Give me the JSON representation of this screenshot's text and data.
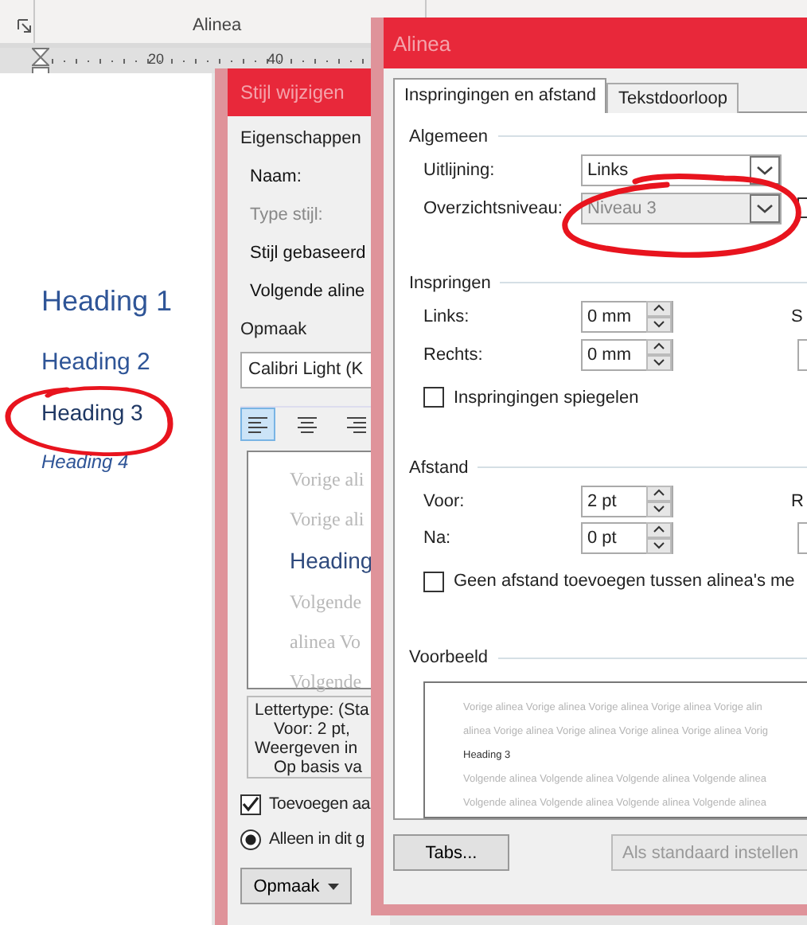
{
  "ribbon": {
    "group_label": "Alinea"
  },
  "ruler": {
    "marks": [
      "20",
      "40"
    ]
  },
  "document": {
    "headings": [
      {
        "kind": "h1",
        "text": "Heading 1"
      },
      {
        "kind": "h2",
        "text": "Heading 2"
      },
      {
        "kind": "h3",
        "text": "Heading 3"
      },
      {
        "kind": "h4",
        "text": "Heading 4"
      }
    ]
  },
  "style_dialog": {
    "title": "Stijl wijzigen",
    "properties_heading": "Eigenschappen",
    "fields": [
      {
        "label": "Naam:",
        "disabled": false
      },
      {
        "label": "Type stijl:",
        "disabled": true
      },
      {
        "label": "Stijl gebaseerd",
        "disabled": false
      },
      {
        "label": "Volgende aline",
        "disabled": false
      }
    ],
    "format_heading": "Opmaak",
    "font": "Calibri Light (K",
    "alignment_buttons": [
      {
        "selected": true
      },
      {
        "selected": false
      },
      {
        "selected": false
      }
    ],
    "preview_lines": [
      {
        "kind": "previous",
        "text": "Vorige ali"
      },
      {
        "kind": "previous",
        "text": "Vorige ali"
      },
      {
        "kind": "current",
        "text": "Heading"
      },
      {
        "kind": "next",
        "text": "Volgende"
      },
      {
        "kind": "next",
        "text": "alinea Vo"
      },
      {
        "kind": "next",
        "text": "Volgende"
      }
    ],
    "description_lines": [
      {
        "indented": false,
        "text": "Lettertype: (Sta"
      },
      {
        "indented": true,
        "text": "Voor:  2 pt,"
      },
      {
        "indented": false,
        "text": "Weergeven in"
      },
      {
        "indented": true,
        "text": "Op basis va"
      }
    ],
    "add_to_gallery": {
      "label": "Toevoegen aa",
      "checked": true
    },
    "scope_option": {
      "label": "Alleen in dit g",
      "selected": true
    },
    "format_button": "Opmaak"
  },
  "paragraph_dialog": {
    "title": "Alinea",
    "tabs": [
      {
        "label": "Inspringingen en afstand",
        "selected": true
      },
      {
        "label": "Tekstdoorloop",
        "selected": false
      }
    ],
    "general": {
      "heading": "Algemeen",
      "rows": [
        {
          "label": "Uitlijning:",
          "value": "Links",
          "disabled": false
        },
        {
          "label": "Overzichtsniveau:",
          "value": "Niveau 3",
          "disabled": true
        }
      ],
      "side_checkbox": {
        "checked": false
      }
    },
    "indentation": {
      "heading": "Inspringen",
      "rows": [
        {
          "label": "Links:",
          "value": "0 mm"
        },
        {
          "label": "Rechts:",
          "value": "0 mm"
        }
      ],
      "side_label": "S",
      "mirror": {
        "label": "Inspringingen spiegelen",
        "checked": false
      }
    },
    "spacing": {
      "heading": "Afstand",
      "rows": [
        {
          "label": "Voor:",
          "value": "2 pt"
        },
        {
          "label": "Na:",
          "value": "0 pt"
        }
      ],
      "side_label": "R",
      "no_space": {
        "label": "Geen afstand toevoegen tussen alinea's me",
        "checked": false
      }
    },
    "preview": {
      "heading": "Voorbeeld",
      "lines": [
        {
          "kind": "previous",
          "text": "Vorige alinea Vorige alinea Vorige alinea Vorige alinea Vorige alin"
        },
        {
          "kind": "previous",
          "text": "alinea Vorige alinea Vorige alinea Vorige alinea Vorige alinea Vorig"
        },
        {
          "kind": "current",
          "text": "Heading 3"
        },
        {
          "kind": "next",
          "text": "Volgende alinea Volgende alinea Volgende alinea Volgende alinea"
        },
        {
          "kind": "next",
          "text": "Volgende alinea Volgende alinea Volgende alinea Volgende alinea"
        }
      ]
    },
    "buttons": [
      {
        "label": "Tabs...",
        "disabled": false
      },
      {
        "label": "Als standaard instellen",
        "disabled": true
      }
    ]
  }
}
